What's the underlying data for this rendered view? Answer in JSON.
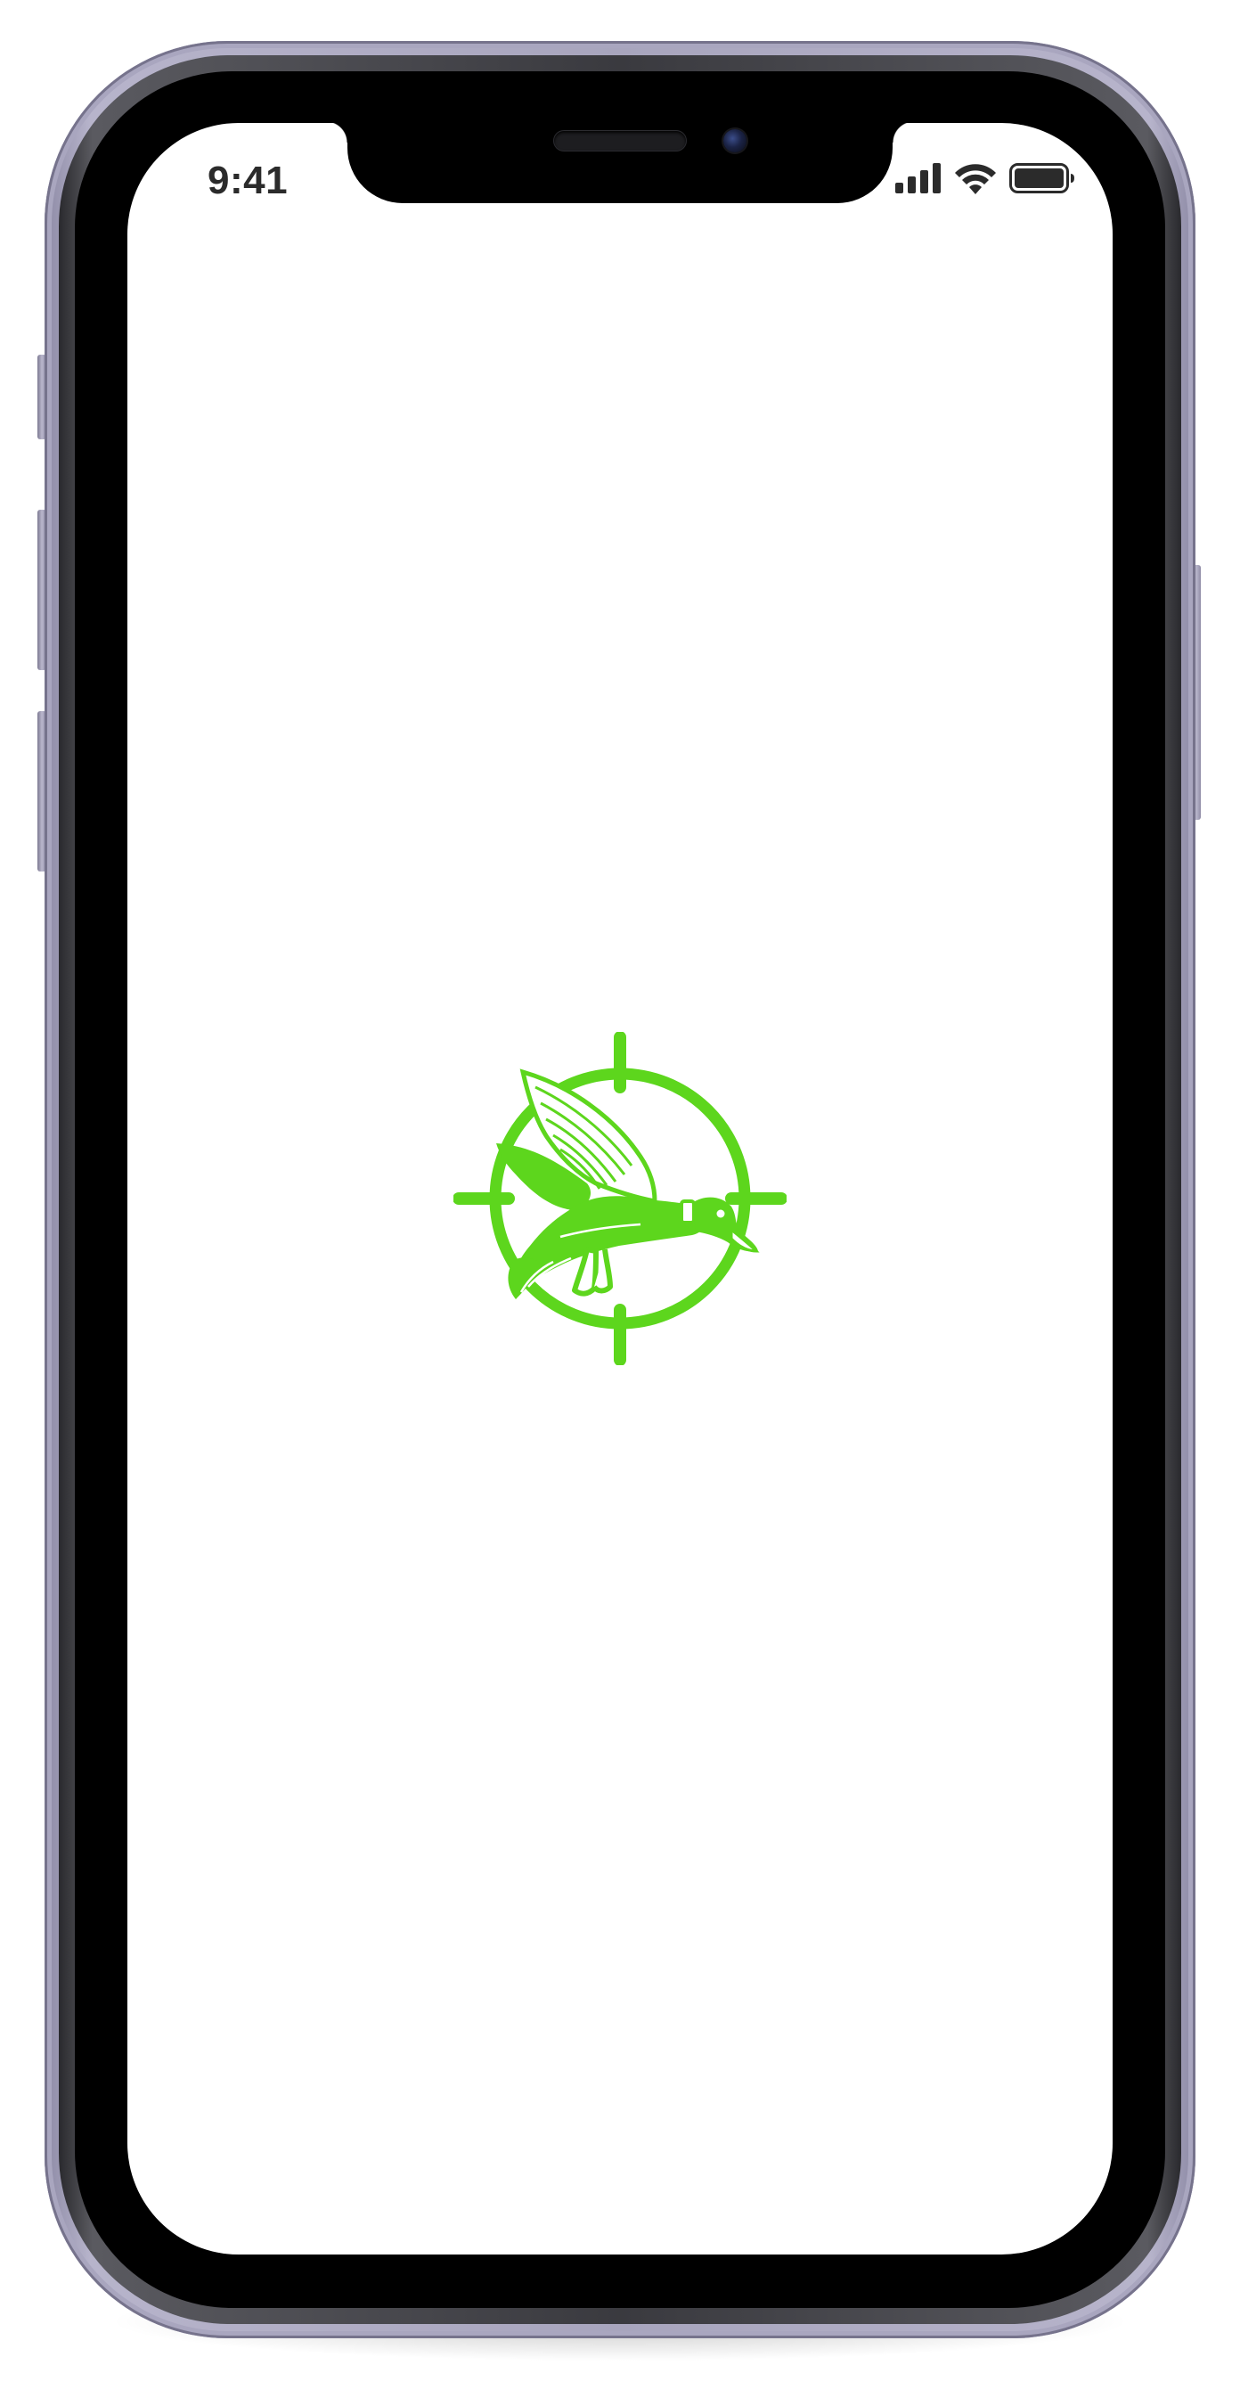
{
  "status_bar": {
    "time": "9:41",
    "icons": [
      "cellular-signal-icon",
      "wifi-icon",
      "battery-icon"
    ]
  },
  "splash": {
    "logo_icon": "duck-crosshair-logo-icon",
    "accent_color": "#5dd61d"
  },
  "device": {
    "frame_color": "#a8a5bd"
  }
}
